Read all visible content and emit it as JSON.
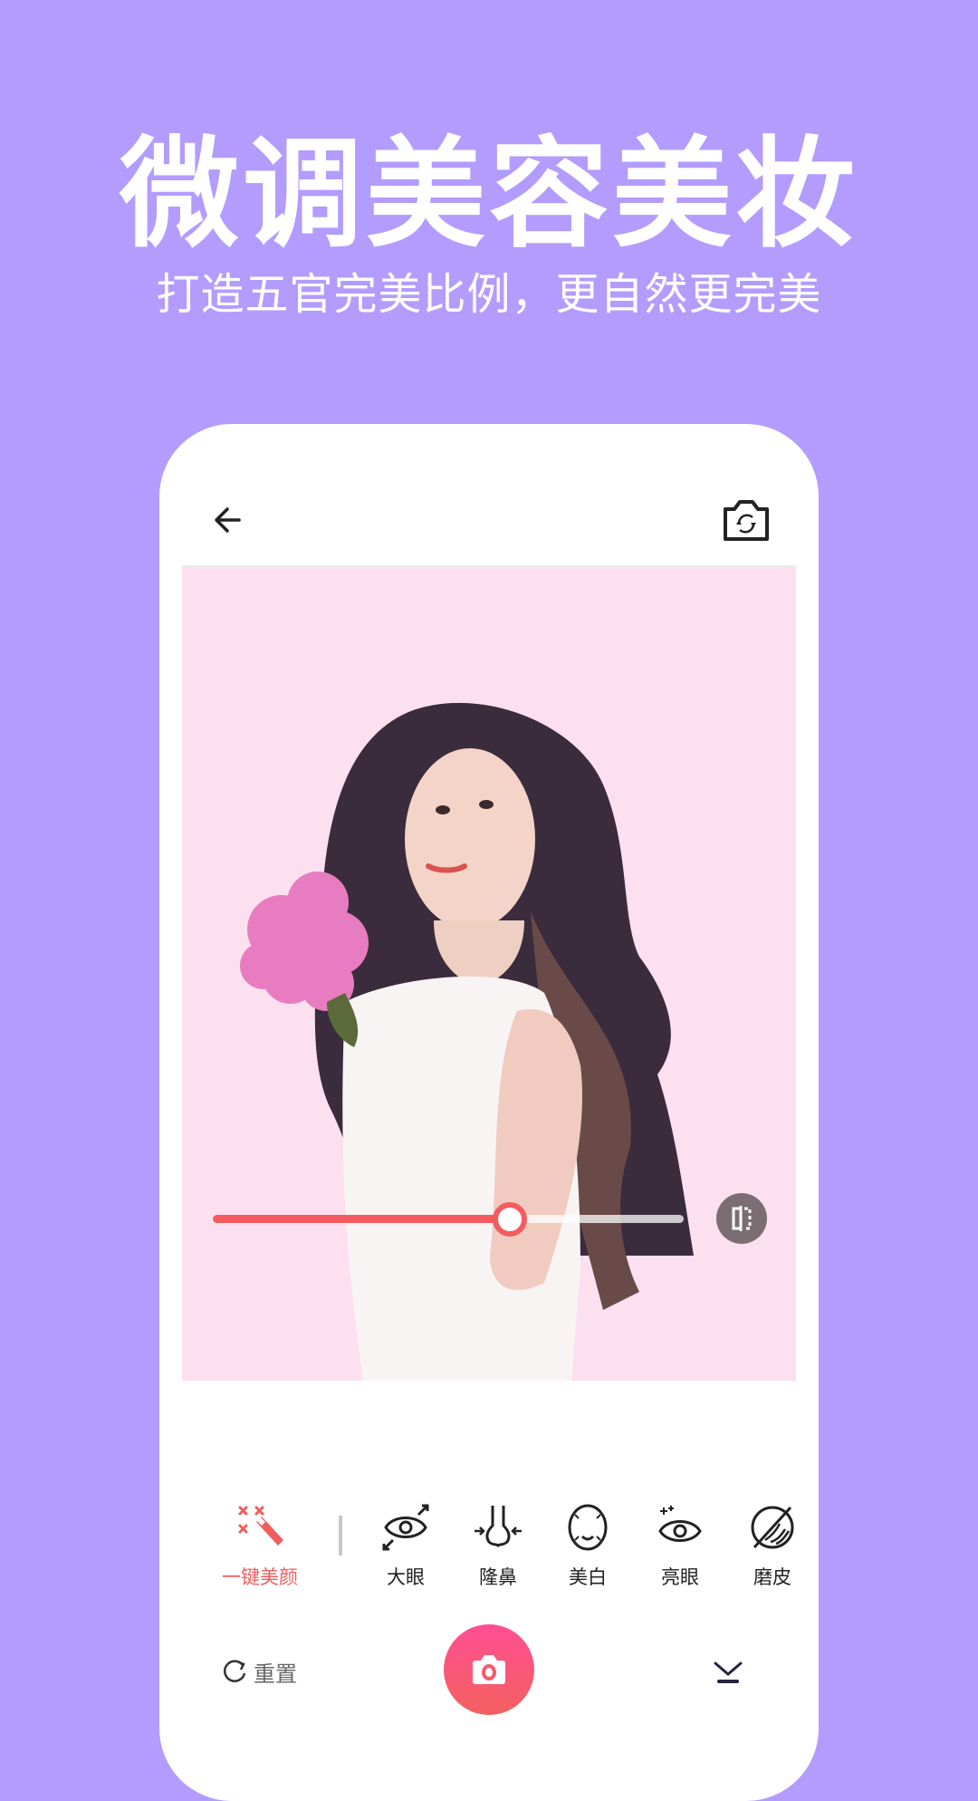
{
  "promo": {
    "headline": "微调美容美妆",
    "subline": "打造五官完美比例，更自然更完美"
  },
  "colors": {
    "background": "#b39cfe",
    "accent": "#f45b5f",
    "photo_bg": "#fde0f0",
    "shutter_gradient": [
      "#ff4f93",
      "#f4605f"
    ]
  },
  "topbar": {
    "back_icon": "arrow-left-icon",
    "flip_icon": "camera-switch-icon"
  },
  "slider": {
    "value_fraction": 0.63,
    "compare_icon": "compare-icon"
  },
  "tools": [
    {
      "label": "一键美颜",
      "icon": "magic-wand-icon",
      "active": true
    },
    {
      "label": "大眼",
      "icon": "big-eye-icon",
      "active": false
    },
    {
      "label": "隆鼻",
      "icon": "nose-icon",
      "active": false
    },
    {
      "label": "美白",
      "icon": "face-whiten-icon",
      "active": false
    },
    {
      "label": "亮眼",
      "icon": "bright-eye-icon",
      "active": false
    },
    {
      "label": "磨皮",
      "icon": "skin-smooth-icon",
      "active": false
    }
  ],
  "bottom": {
    "reset_label": "重置",
    "shutter_icon": "camera-icon",
    "collapse_icon": "chevron-down-icon"
  }
}
